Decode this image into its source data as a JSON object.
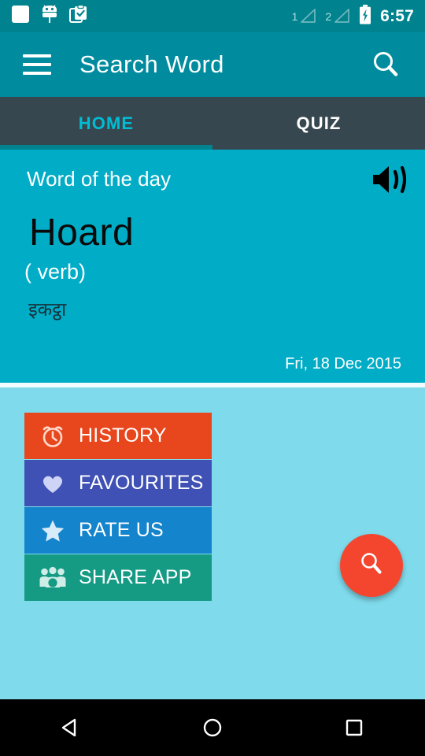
{
  "status_bar": {
    "icons": [
      "white-square-icon",
      "android-robot-icon",
      "clipboard-check-icon"
    ],
    "sim1_label": "1",
    "sim2_label": "2",
    "battery": "battery-charging-icon",
    "time": "6:57",
    "background": "#00838F"
  },
  "app_bar": {
    "menu_icon": "hamburger-menu-icon",
    "title": "Search Word",
    "search_icon": "search-icon",
    "background": "#008C9E"
  },
  "tabs": {
    "background": "#37474F",
    "active_color": "#00BCD4",
    "indicator_color": "#00838F",
    "items": [
      {
        "label": "HOME",
        "active": true
      },
      {
        "label": "QUIZ",
        "active": false
      }
    ]
  },
  "word_card": {
    "background": "#00ACC6",
    "label": "Word of the day",
    "speaker_icon": "speaker-volume-icon",
    "word": "Hoard",
    "part_of_speech": "( verb)",
    "translation": "इकट्ठा",
    "date": "Fri, 18 Dec 2015"
  },
  "body": {
    "background": "#7FDBEC",
    "actions": [
      {
        "label": "HISTORY",
        "icon": "alarm-clock-icon",
        "color": "#E8461C"
      },
      {
        "label": "FAVOURITES",
        "icon": "heart-icon",
        "color": "#3F51B5"
      },
      {
        "label": "RATE US",
        "icon": "star-icon",
        "color": "#1484CC"
      },
      {
        "label": "SHARE APP",
        "icon": "people-group-icon",
        "color": "#159A84"
      }
    ]
  },
  "fab": {
    "icon": "search-icon",
    "color": "#F4462F"
  },
  "nav_bar": {
    "background": "#000000",
    "buttons": [
      "back-triangle-icon",
      "home-circle-icon",
      "recents-square-icon"
    ]
  }
}
